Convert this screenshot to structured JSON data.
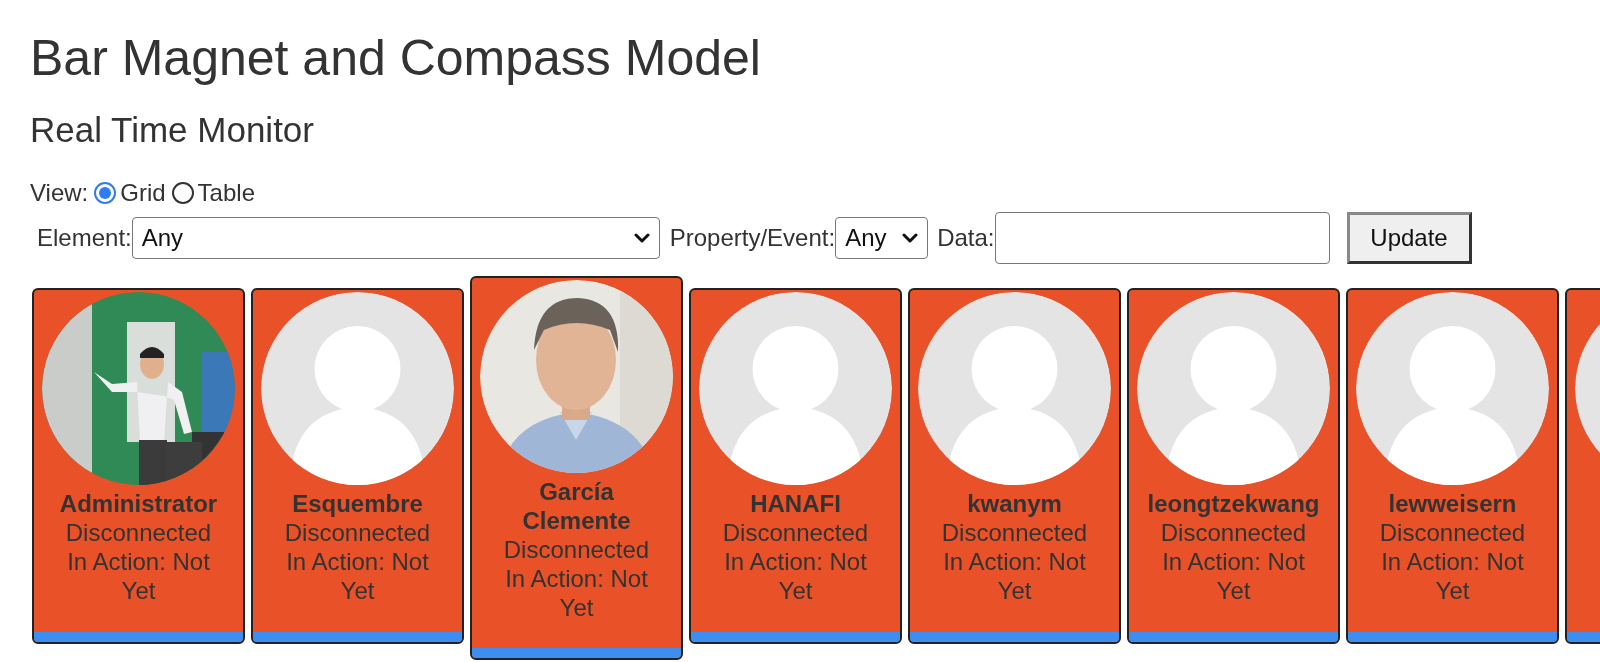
{
  "title": "Bar Magnet and Compass Model",
  "subtitle": "Real Time Monitor",
  "view": {
    "label": "View:",
    "options": [
      {
        "label": "Grid",
        "selected": true
      },
      {
        "label": "Table",
        "selected": false
      }
    ]
  },
  "filters": {
    "element": {
      "label": "Element:",
      "value": "Any"
    },
    "property": {
      "label": "Property/Event:",
      "value": "Any"
    },
    "data": {
      "label": "Data:"
    },
    "button": "Update"
  },
  "users": [
    {
      "name": "Administrator",
      "status": "Disconnected",
      "action": "In Action: Not Yet",
      "selected": false
    },
    {
      "name": "Esquembre",
      "kind": "placeholder",
      "status": "Disconnected",
      "action": "In Action: Not Yet",
      "selected": false
    },
    {
      "name": "García Clemente",
      "status": "Disconnected",
      "action": "In Action: Not Yet",
      "selected": true
    },
    {
      "name": "HANAFI",
      "kind": "placeholder",
      "status": "Disconnected",
      "action": "In Action: Not Yet",
      "selected": false
    },
    {
      "name": "kwanym",
      "kind": "placeholder",
      "status": "Disconnected",
      "action": "In Action: Not Yet",
      "selected": false
    },
    {
      "name": "leongtzekwang",
      "kind": "placeholder",
      "status": "Disconnected",
      "action": "In Action: Not Yet",
      "selected": false
    },
    {
      "name": "lewweisern",
      "kind": "placeholder",
      "status": "Disconnected",
      "action": "In Action: Not Yet",
      "selected": false
    },
    {
      "kind": "placeholder",
      "selected": false
    }
  ]
}
